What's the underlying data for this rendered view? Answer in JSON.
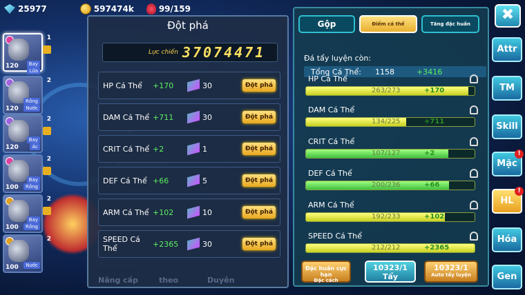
{
  "top": {
    "gems": "25977",
    "gold": "597474k",
    "stamina": "99/159"
  },
  "heroes": [
    {
      "level": "120",
      "tags": [
        "Bay",
        "Lửa"
      ],
      "star": "1",
      "star2": "2"
    },
    {
      "level": "120",
      "tags": [
        "Rồng",
        "Nước"
      ],
      "star": "2"
    },
    {
      "level": "120",
      "tags": [
        "Bay",
        "Ác"
      ],
      "star": "2"
    },
    {
      "level": "100",
      "tags": [
        "Bay",
        "Rồng"
      ],
      "star": "2"
    },
    {
      "level": "100",
      "tags": [
        "Bay",
        "Rồng"
      ],
      "star": "2"
    },
    {
      "level": "100",
      "tags": [
        "Nước"
      ],
      "star": "2"
    }
  ],
  "left_panel": {
    "title": "Đột phá",
    "power_label": "Lực chiến",
    "power_value": "37074471",
    "rows": [
      {
        "name": "HP Cá Thể",
        "bonus": "+170",
        "count": "30",
        "button": "Đột phá"
      },
      {
        "name": "DAM Cá Thể",
        "bonus": "+711",
        "count": "30",
        "button": "Đột phá"
      },
      {
        "name": "CRIT Cá Thể",
        "bonus": "+2",
        "count": "1",
        "button": "Đột phá"
      },
      {
        "name": "DEF Cá Thể",
        "bonus": "+66",
        "count": "5",
        "button": "Đột phá"
      },
      {
        "name": "ARM Cá Thể",
        "bonus": "+102",
        "count": "10",
        "button": "Đột phá"
      },
      {
        "name": "SPEED Cá Thể",
        "bonus": "+2365",
        "count": "30",
        "button": "Đột phá"
      }
    ],
    "ghost_labels": [
      "Nâng cấp",
      "theo",
      "Duyên"
    ]
  },
  "right_panel": {
    "tabs": [
      "Gộp",
      "Điểm cá thể",
      "Tăng đặc huấn"
    ],
    "remaining_label": "Đá tẩy luyện còn:",
    "total_label": "Tổng Cá Thể:",
    "total_value": "1158",
    "total_bonus": "+3416",
    "stats": [
      {
        "name": "HP Cá Thể",
        "value": "263/273",
        "bonus": "+170",
        "fill": 0.963
      },
      {
        "name": "DAM Cá Thể",
        "value": "134/225",
        "bonus": "+711",
        "fill": 0.596
      },
      {
        "name": "CRIT Cá Thể",
        "value": "107/127",
        "bonus": "+2",
        "fill": 0.843
      },
      {
        "name": "DEF Cá Thể",
        "value": "200/236",
        "bonus": "+66",
        "fill": 0.847
      },
      {
        "name": "ARM Cá Thể",
        "value": "192/233",
        "bonus": "+102",
        "fill": 0.824
      },
      {
        "name": "SPEED Cá Thể",
        "value": "212/212",
        "bonus": "+2365",
        "fill": 1.0
      }
    ],
    "buttons": {
      "special": "Đặc huấn cực hạn",
      "special_sub": "Đặc cách",
      "wash_count": "10323/1",
      "wash": "Tẩy",
      "auto_count": "10323/1",
      "auto": "Auto tẩy luyện"
    }
  },
  "nav": [
    "Attr",
    "TM",
    "Skill",
    "Mặc",
    "HL",
    "Hóa",
    "Gen"
  ],
  "nav_badge": "!",
  "close_label": "✖"
}
